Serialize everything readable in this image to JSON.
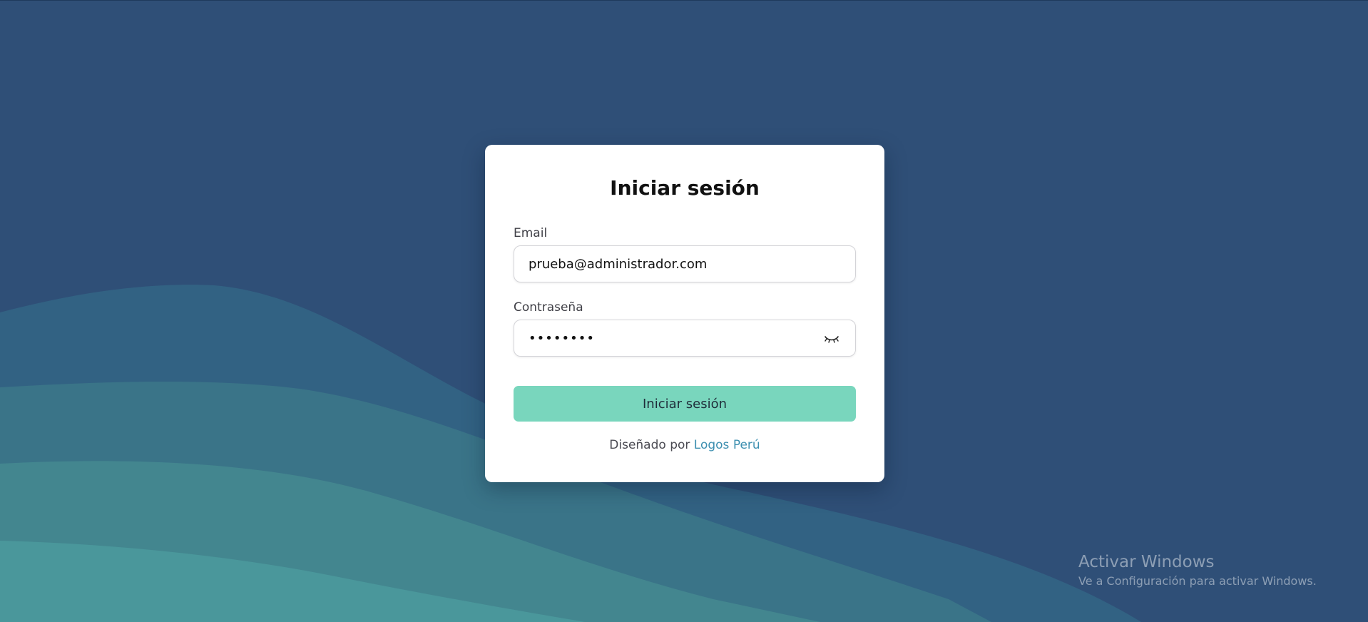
{
  "colors": {
    "background": "#2f4f77",
    "button": "#79d6bd",
    "link": "#3d8fb0"
  },
  "login": {
    "title": "Iniciar sesión",
    "email_label": "Email",
    "email_value": "prueba@administrador.com",
    "password_label": "Contraseña",
    "password_value": "••••••••",
    "toggle_icon": "eye-closed-icon",
    "submit_label": "Iniciar sesión",
    "credit_prefix": "Diseñado por",
    "credit_link": "Logos Perú"
  },
  "watermark": {
    "title": "Activar Windows",
    "subtitle": "Ve a Configuración para activar Windows."
  }
}
